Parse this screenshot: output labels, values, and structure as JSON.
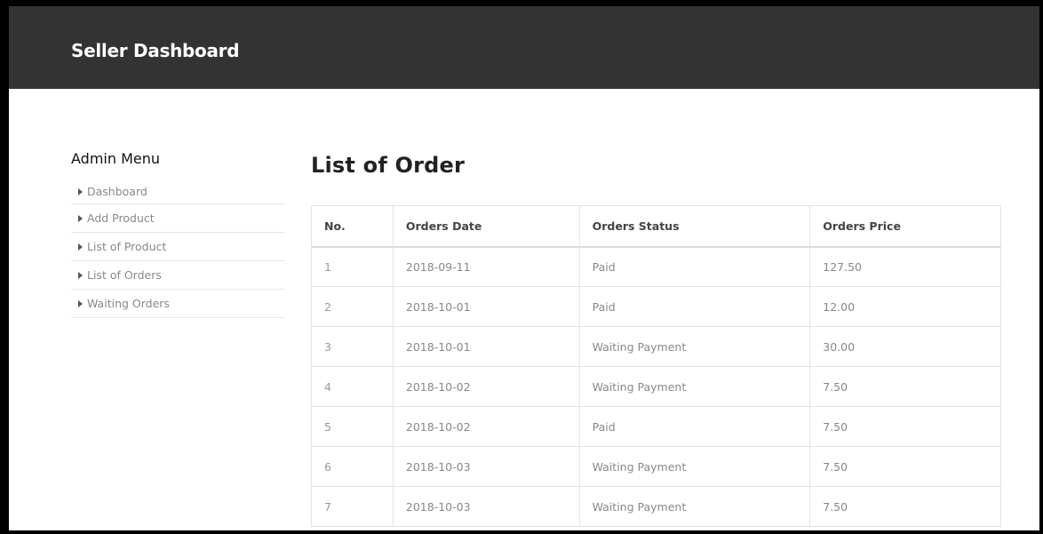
{
  "header": {
    "brand": "Seller Dashboard"
  },
  "sidebar": {
    "title": "Admin Menu",
    "items": [
      {
        "label": "Dashboard"
      },
      {
        "label": "Add Product"
      },
      {
        "label": "List of Product"
      },
      {
        "label": "List of Orders"
      },
      {
        "label": "Waiting Orders"
      }
    ]
  },
  "main": {
    "title": "List of Order",
    "table": {
      "headers": [
        "No.",
        "Orders Date",
        "Orders Status",
        "Orders Price"
      ],
      "rows": [
        [
          "1",
          "2018-09-11",
          "Paid",
          "127.50"
        ],
        [
          "2",
          "2018-10-01",
          "Paid",
          "12.00"
        ],
        [
          "3",
          "2018-10-01",
          "Waiting Payment",
          "30.00"
        ],
        [
          "4",
          "2018-10-02",
          "Waiting Payment",
          "7.50"
        ],
        [
          "5",
          "2018-10-02",
          "Paid",
          "7.50"
        ],
        [
          "6",
          "2018-10-03",
          "Waiting Payment",
          "7.50"
        ],
        [
          "7",
          "2018-10-03",
          "Waiting Payment",
          "7.50"
        ]
      ]
    }
  },
  "colors": {
    "topbar": "#333333",
    "brand_text": "#ffffff",
    "menu_text": "#888888",
    "border": "#e3e3e3"
  }
}
